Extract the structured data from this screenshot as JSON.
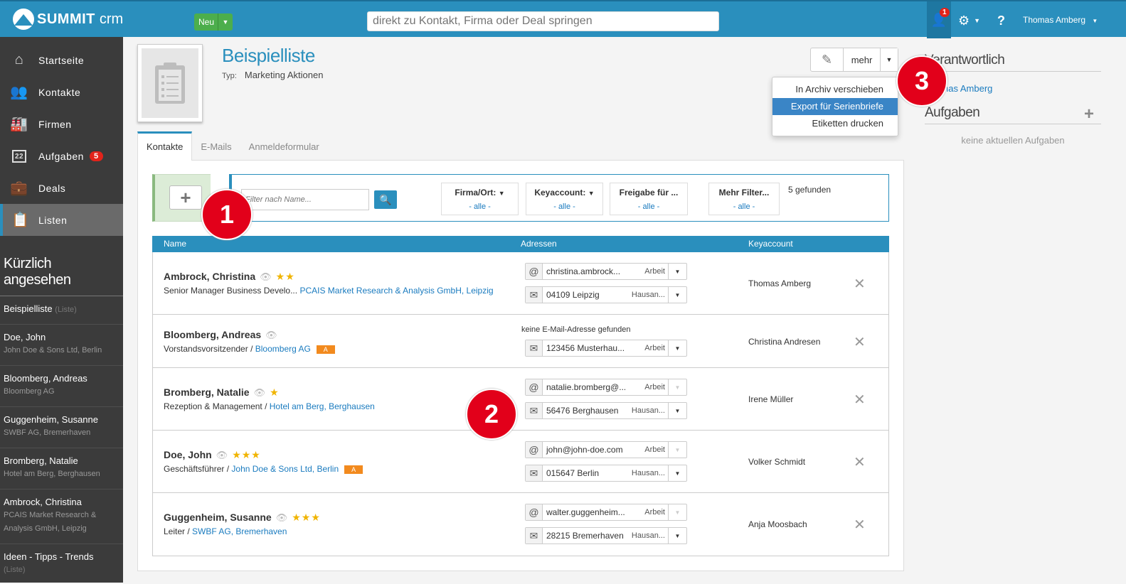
{
  "topbar": {
    "logo_bold": "SUMMIT",
    "logo_light": "crm",
    "new_button": "Neu",
    "search_placeholder": "direkt zu Kontakt, Firma oder Deal springen",
    "notification_count": "1",
    "help_label": "?",
    "user_name": "Thomas Amberg",
    "brand_color": "#2a8fbd"
  },
  "sidebar": {
    "items": [
      {
        "label": "Startseite",
        "icon": "home-icon"
      },
      {
        "label": "Kontakte",
        "icon": "contacts-icon"
      },
      {
        "label": "Firmen",
        "icon": "factory-icon"
      },
      {
        "label": "Aufgaben",
        "icon": "calendar-icon",
        "badge": "5",
        "icon_text": "22"
      },
      {
        "label": "Deals",
        "icon": "briefcase-icon"
      },
      {
        "label": "Listen",
        "icon": "clipboard-icon",
        "active": true
      }
    ],
    "recent_heading": "Kürzlich angesehen",
    "recent": [
      {
        "title": "Beispielliste",
        "tag": "(Liste)",
        "sub": ""
      },
      {
        "title": "Doe, John",
        "sub": "John Doe & Sons Ltd, Berlin"
      },
      {
        "title": "Bloomberg, Andreas",
        "sub": "Bloomberg AG"
      },
      {
        "title": "Guggenheim, Susanne",
        "sub": "SWBF AG, Bremerhaven"
      },
      {
        "title": "Bromberg, Natalie",
        "sub": "Hotel am Berg, Berghausen"
      },
      {
        "title": "Ambrock, Christina",
        "sub": "PCAIS Market Research & Analysis GmbH, Leipzig"
      },
      {
        "title": "Ideen - Tipps - Trends",
        "tag": "(Liste)",
        "sub": ""
      }
    ]
  },
  "list": {
    "title": "Beispielliste",
    "type_label": "Typ:",
    "type_value": "Marketing Aktionen",
    "more_button": "mehr",
    "menu": [
      "In Archiv verschieben",
      "Export für Serienbriefe",
      "Etiketten drucken"
    ]
  },
  "right_panel": {
    "responsible_heading": "Verantwortlich",
    "responsible_name": "Thomas Amberg",
    "tasks_heading": "Aufgaben",
    "no_tasks": "keine aktuellen Aufgaben"
  },
  "tabs": [
    "Kontakte",
    "E-Mails",
    "Anmeldeformular"
  ],
  "filters": {
    "name_placeholder": "Filter nach Name...",
    "dropdowns": [
      {
        "label": "Firma/Ort:",
        "value": "- alle -"
      },
      {
        "label": "Keyaccount:",
        "value": "- alle -"
      },
      {
        "label": "Freigabe für ...",
        "value": "- alle -"
      },
      {
        "label": "Mehr Filter...",
        "value": "- alle -"
      }
    ],
    "found": "5 gefunden"
  },
  "table": {
    "columns": [
      "Name",
      "Adressen",
      "Keyaccount"
    ],
    "rows": [
      {
        "name": "Ambrock, Christina",
        "stars": "★★",
        "position": "Senior Manager Business Develo...",
        "company": "PCAIS Market Research & Analysis GmbH, Leipzig",
        "tag": "",
        "email": "christina.ambrock...",
        "email_type": "Arbeit",
        "address": "04109  Leipzig",
        "address_type": "Hausan...",
        "keyaccount": "Thomas Amberg"
      },
      {
        "name": "Bloomberg, Andreas",
        "stars": "",
        "position": "Vorstandsvorsitzender /",
        "company": "Bloomberg AG",
        "tag": "A",
        "no_email": "keine E-Mail-Adresse gefunden",
        "address": "123456 Musterhau...",
        "address_type": "Arbeit",
        "keyaccount": "Christina Andresen"
      },
      {
        "name": "Bromberg, Natalie",
        "stars": "★",
        "position": "Rezeption & Management /",
        "company": "Hotel am Berg, Berghausen",
        "tag": "",
        "email": "natalie.bromberg@...",
        "email_type": "Arbeit",
        "address": "56476  Berghausen",
        "address_type": "Hausan...",
        "keyaccount": "Irene Müller"
      },
      {
        "name": "Doe, John",
        "stars": "★★★",
        "position": "Geschäftsführer /",
        "company": "John Doe & Sons Ltd, Berlin",
        "tag": "A",
        "email": "john@john-doe.com",
        "email_type": "Arbeit",
        "address": "015647  Berlin",
        "address_type": "Hausan...",
        "keyaccount": "Volker Schmidt"
      },
      {
        "name": "Guggenheim, Susanne",
        "stars": "★★★",
        "position": "Leiter /",
        "company": "SWBF AG, Bremerhaven",
        "tag": "",
        "email": "walter.guggenheim...",
        "email_type": "Arbeit",
        "address": "28215  Bremerhaven",
        "address_type": "Hausan...",
        "keyaccount": "Anja Moosbach"
      }
    ]
  },
  "callouts": [
    "1",
    "2",
    "3"
  ]
}
